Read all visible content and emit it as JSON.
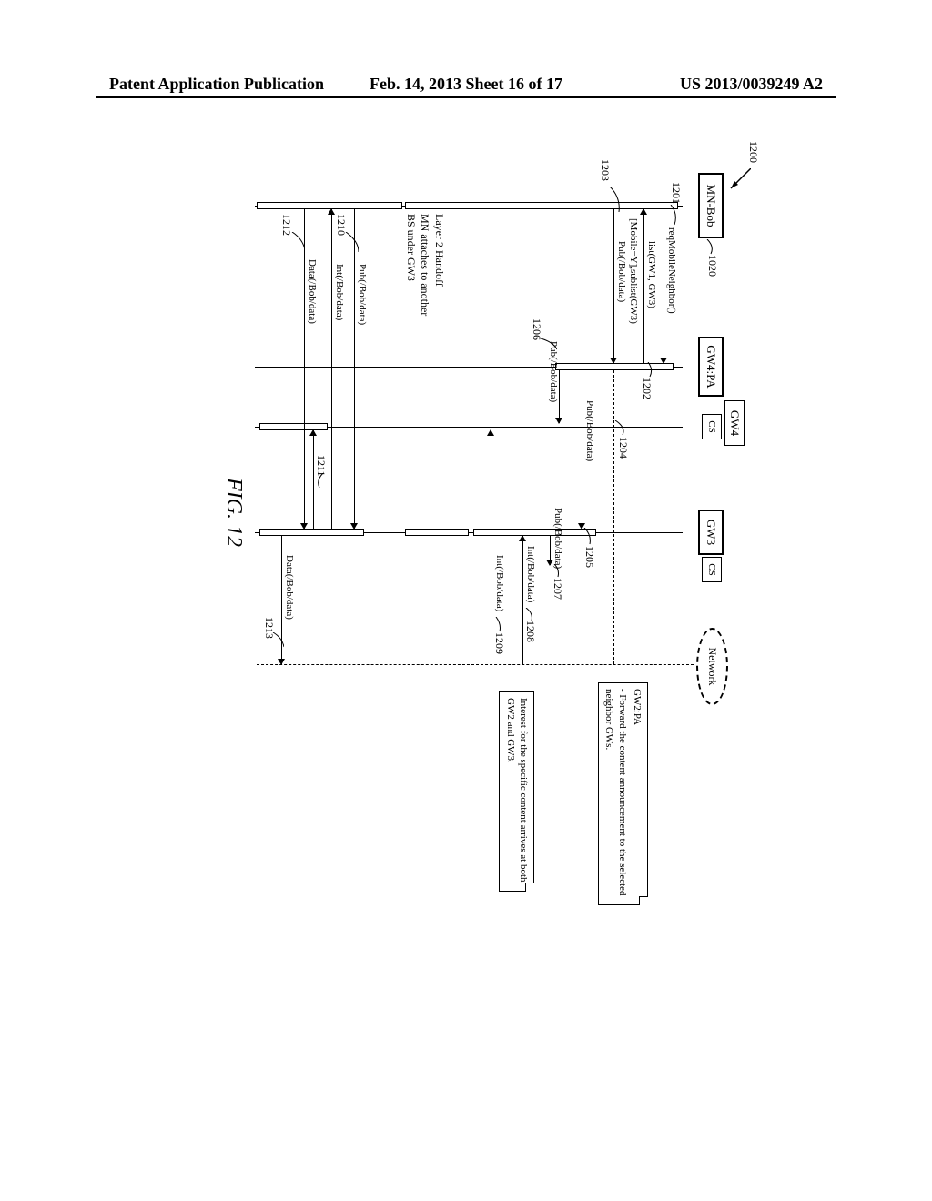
{
  "header": {
    "left": "Patent Application Publication",
    "center": "Feb. 14, 2013  Sheet 16 of 17",
    "right": "US 2013/0039249 A2"
  },
  "figure": {
    "ref_main": "1200",
    "label": "FIG. 12",
    "entities": {
      "mn_bob": "MN-Bob",
      "gw4_pa": "GW4:PA",
      "gw4": "GW4",
      "gw3": "GW3",
      "cs": "CS",
      "network": "Network"
    },
    "refs": {
      "r1020": "1020",
      "r1201": "1201",
      "r1202": "1202",
      "r1203": "1203",
      "r1204": "1204",
      "r1205": "1205",
      "r1206": "1206",
      "r1207": "1207",
      "r1208": "1208",
      "r1209": "1209",
      "r1210": "1210",
      "r1211": "1211",
      "r1212": "1212",
      "r1213": "1213"
    },
    "messages": {
      "req_neighbor": "reqMobileNeighbor()",
      "list_gw": "list(GW1, GW3)",
      "mobile_sublist": "[Mobile=Y],sublist(GW3)",
      "pub_bob": "Pub(/Bob/data)",
      "int_bob": "Int(/Bob/data)",
      "data_bob": "Data(/Bob/data)"
    },
    "notes": {
      "gw2_title": "GW2:PA",
      "gw2_body": "- Forward the content announcement to the selected neighbor GWs.",
      "interest_body": "Interest for the specific content arrives at both GW2 and GW3."
    },
    "side": {
      "handoff_line1": "Layer 2 Handoff",
      "handoff_line2": "MN attaches to another",
      "handoff_line3": "BS under GW3"
    }
  }
}
